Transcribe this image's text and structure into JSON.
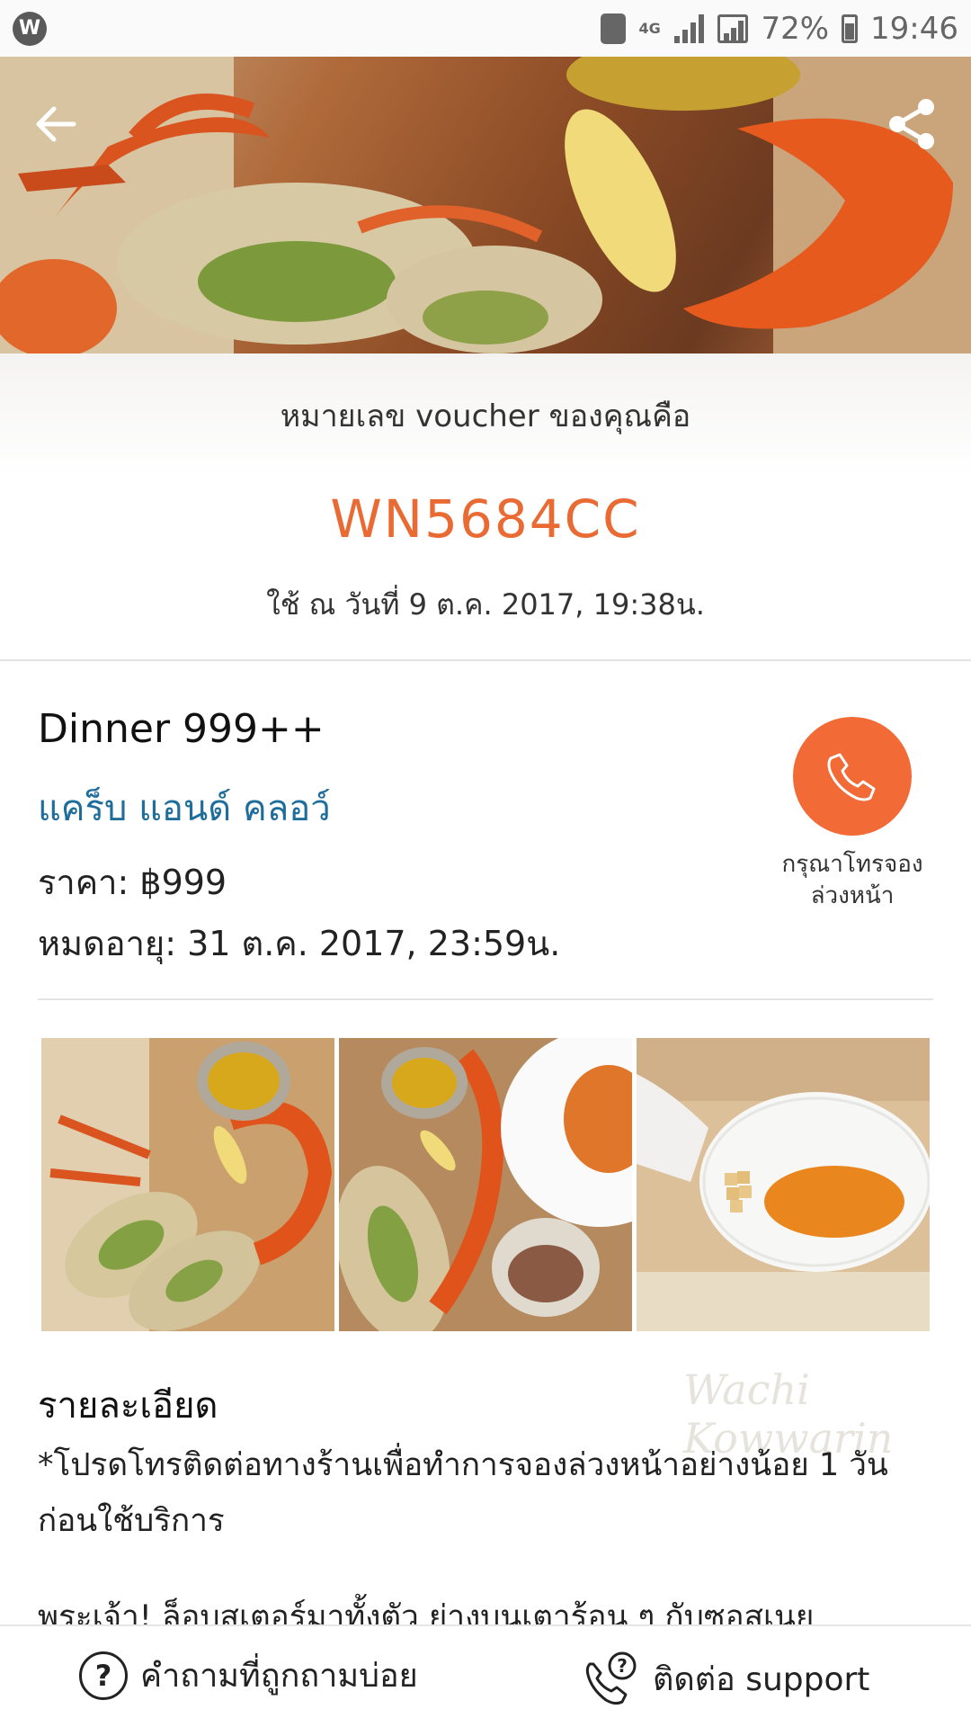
{
  "status_bar": {
    "app_icon_letter": "W",
    "network": "4G",
    "battery": "72%",
    "time": "19:46"
  },
  "hero": {
    "back_icon": "arrow-left-icon",
    "share_icon": "share-icon"
  },
  "voucher": {
    "label": "หมายเลข voucher ของคุณคือ",
    "code": "WN5684CC",
    "used_at": "ใช้ ณ วันที่ 9 ต.ค. 2017, 19:38น."
  },
  "deal": {
    "title": "Dinner 999++",
    "restaurant": "แคร็บ แอนด์ คลอว์",
    "price": "ราคา: ฿999",
    "expiry": "หมดอายุ: 31 ต.ค. 2017, 23:59น.",
    "call_caption_line1": "กรุณาโทรจอง",
    "call_caption_line2": "ล่วงหน้า"
  },
  "details": {
    "heading": "รายละเอียด",
    "watermark": "Wachi Kowwarin",
    "body": "*โปรดโทรติดต่อทางร้านเพื่อทำการจองล่วงหน้าอย่างน้อย 1 วัน ก่อนใช้บริการ",
    "more": "พระเจ้า! ล็อบสเตอร์มาทั้งตัว ย่างบนเตาร้อน ๆ กับซอสเนย"
  },
  "bottom_bar": {
    "faq_label": "คำถามที่ถูกถามบ่อย",
    "support_label": "ติดต่อ support"
  },
  "colors": {
    "accent_orange": "#ea6a33",
    "call_button": "#f26a35",
    "restaurant_blue": "#1f6d9a"
  }
}
